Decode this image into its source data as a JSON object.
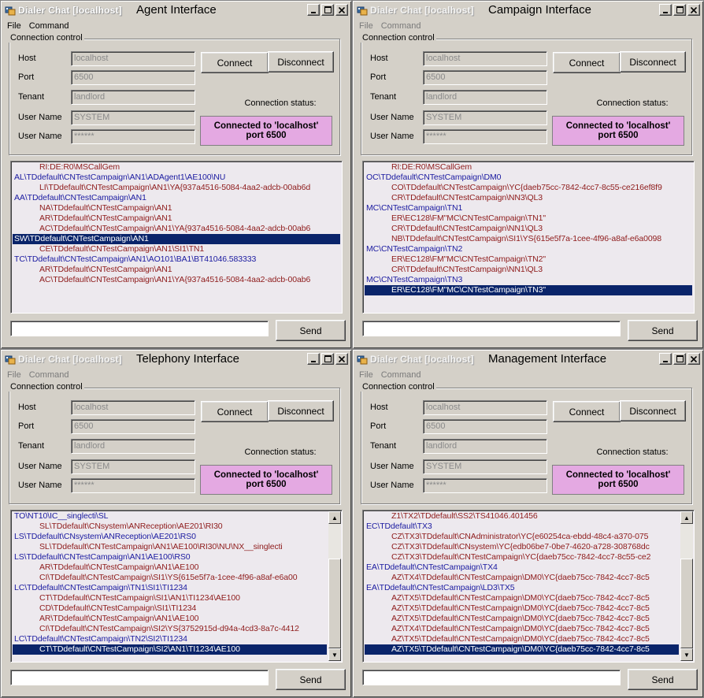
{
  "windows": [
    {
      "app_title": "Dialer Chat [localhost]",
      "interface_title": "Agent Interface",
      "active": true,
      "menu": [
        "File",
        "Command"
      ],
      "group_label": "Connection control",
      "fields": [
        {
          "label": "Host",
          "value": "localhost"
        },
        {
          "label": "Port",
          "value": "6500"
        },
        {
          "label": "Tenant",
          "value": "landlord"
        },
        {
          "label": "User Name",
          "value": "SYSTEM"
        },
        {
          "label": "User Name",
          "value": "******"
        }
      ],
      "connect_label": "Connect",
      "disconnect_label": "Disconnect",
      "status_label": "Connection status:",
      "status_text": "Connected to 'localhost' port 6500",
      "send_label": "Send",
      "input_value": "",
      "has_scrollbar": false,
      "log": [
        {
          "text": "RI:DE:R0\\MSCallGem",
          "color": "red"
        },
        {
          "text": "AL\\TDdefault\\CNTestCampaign\\AN1\\ADAgent1\\AE100\\NU",
          "color": "blue"
        },
        {
          "text": "LI\\TDdefault\\CNTestCampaign\\AN1\\YA{937a4516-5084-4aa2-adcb-00ab6d",
          "color": "red"
        },
        {
          "text": "AA\\TDdefault\\CNTestCampaign\\AN1",
          "color": "blue"
        },
        {
          "text": "NA\\TDdefault\\CNTestCampaign\\AN1",
          "color": "red"
        },
        {
          "text": "AR\\TDdefault\\CNTestCampaign\\AN1",
          "color": "red"
        },
        {
          "text": "AC\\TDdefault\\CNTestCampaign\\AN1\\YA{937a4516-5084-4aa2-adcb-00ab6",
          "color": "red"
        },
        {
          "text": "SW\\TDdefault\\CNTestCampaign\\AN1",
          "color": "blue",
          "selected": true
        },
        {
          "text": "CE\\TDdefault\\CNTestCampaign\\AN1\\SI1\\TN1",
          "color": "red"
        },
        {
          "text": "TC\\TDdefault\\CNTestCampaign\\AN1\\AO101\\BA1\\BT41046.583333",
          "color": "blue"
        },
        {
          "text": "AR\\TDdefault\\CNTestCampaign\\AN1",
          "color": "red"
        },
        {
          "text": "AC\\TDdefault\\CNTestCampaign\\AN1\\YA{937a4516-5084-4aa2-adcb-00ab6",
          "color": "red"
        }
      ]
    },
    {
      "app_title": "Dialer Chat [localhost]",
      "interface_title": "Campaign Interface",
      "active": false,
      "menu": [
        "File",
        "Command"
      ],
      "group_label": "Connection control",
      "fields": [
        {
          "label": "Host",
          "value": "localhost"
        },
        {
          "label": "Port",
          "value": "6500"
        },
        {
          "label": "Tenant",
          "value": "landlord"
        },
        {
          "label": "User Name",
          "value": "SYSTEM"
        },
        {
          "label": "User Name",
          "value": "******"
        }
      ],
      "connect_label": "Connect",
      "disconnect_label": "Disconnect",
      "status_label": "Connection status:",
      "status_text": "Connected to 'localhost' port 6500",
      "send_label": "Send",
      "input_value": "",
      "has_scrollbar": false,
      "log": [
        {
          "text": "RI:DE:R0\\MSCallGem",
          "color": "red"
        },
        {
          "text": "OC\\TDdefault\\CNTestCampaign\\DM0",
          "color": "blue"
        },
        {
          "text": "CO\\TDdefault\\CNTestCampaign\\YC{daeb75cc-7842-4cc7-8c55-ce216ef8f9",
          "color": "red"
        },
        {
          "text": "CR\\TDdefault\\CNTestCampaign\\NN3\\QL3",
          "color": "red"
        },
        {
          "text": "MC\\CNTestCampaign\\TN1",
          "color": "blue"
        },
        {
          "text": "ER\\EC128\\FM\"MC\\CNTestCampaign\\TN1\"",
          "color": "red"
        },
        {
          "text": "CR\\TDdefault\\CNTestCampaign\\NN1\\QL3",
          "color": "red"
        },
        {
          "text": "NB\\TDdefault\\CNTestCampaign\\SI1\\YS{615e5f7a-1cee-4f96-a8af-e6a0098",
          "color": "red"
        },
        {
          "text": "MC\\CNTestCampaign\\TN2",
          "color": "blue"
        },
        {
          "text": "ER\\EC128\\FM\"MC\\CNTestCampaign\\TN2\"",
          "color": "red"
        },
        {
          "text": "CR\\TDdefault\\CNTestCampaign\\NN1\\QL3",
          "color": "red"
        },
        {
          "text": "MC\\CNTestCampaign\\TN3",
          "color": "blue"
        },
        {
          "text": "ER\\EC128\\FM\"MC\\CNTestCampaign\\TN3\"",
          "color": "red",
          "selected": true
        }
      ]
    },
    {
      "app_title": "Dialer Chat [localhost]",
      "interface_title": "Telephony Interface",
      "active": false,
      "menu": [
        "File",
        "Command"
      ],
      "group_label": "Connection control",
      "fields": [
        {
          "label": "Host",
          "value": "localhost"
        },
        {
          "label": "Port",
          "value": "6500"
        },
        {
          "label": "Tenant",
          "value": "landlord"
        },
        {
          "label": "User Name",
          "value": "SYSTEM"
        },
        {
          "label": "User Name",
          "value": "******"
        }
      ],
      "connect_label": "Connect",
      "disconnect_label": "Disconnect",
      "status_label": "Connection status:",
      "status_text": "Connected to 'localhost' port 6500",
      "send_label": "Send",
      "input_value": "",
      "has_scrollbar": true,
      "scroll_position": 1.0,
      "log": [
        {
          "text": "TO\\NT10\\IC__singlecti\\SL",
          "color": "blue"
        },
        {
          "text": "SL\\TDdefault\\CNsystem\\ANReception\\AE201\\RI30",
          "color": "red"
        },
        {
          "text": "LS\\TDdefault\\CNsystem\\ANReception\\AE201\\RS0",
          "color": "blue"
        },
        {
          "text": "SL\\TDdefault\\CNTestCampaign\\AN1\\AE100\\RI30\\NU\\NX__singlecti",
          "color": "red"
        },
        {
          "text": "LS\\TDdefault\\CNTestCampaign\\AN1\\AE100\\RS0",
          "color": "blue"
        },
        {
          "text": "AR\\TDdefault\\CNTestCampaign\\AN1\\AE100",
          "color": "red"
        },
        {
          "text": "CI\\TDdefault\\CNTestCampaign\\SI1\\YS{615e5f7a-1cee-4f96-a8af-e6a00",
          "color": "red"
        },
        {
          "text": "LC\\TDdefault\\CNTestCampaign\\TN1\\SI1\\TI1234",
          "color": "blue"
        },
        {
          "text": "CT\\TDdefault\\CNTestCampaign\\SI1\\AN1\\TI1234\\AE100",
          "color": "red"
        },
        {
          "text": "CD\\TDdefault\\CNTestCampaign\\SI1\\TI1234",
          "color": "red"
        },
        {
          "text": "AR\\TDdefault\\CNTestCampaign\\AN1\\AE100",
          "color": "red"
        },
        {
          "text": "CI\\TDdefault\\CNTestCampaign\\SI2\\YS{3752915d-d94a-4cd3-8a7c-4412",
          "color": "red"
        },
        {
          "text": "LC\\TDdefault\\CNTestCampaign\\TN2\\SI2\\TI1234",
          "color": "blue"
        },
        {
          "text": "CT\\TDdefault\\CNTestCampaign\\SI2\\AN1\\TI1234\\AE100",
          "color": "red",
          "selected": true
        }
      ]
    },
    {
      "app_title": "Dialer Chat [localhost]",
      "interface_title": "Management Interface",
      "active": false,
      "menu": [
        "File",
        "Command"
      ],
      "group_label": "Connection control",
      "fields": [
        {
          "label": "Host",
          "value": "localhost"
        },
        {
          "label": "Port",
          "value": "6500"
        },
        {
          "label": "Tenant",
          "value": "landlord"
        },
        {
          "label": "User Name",
          "value": "SYSTEM"
        },
        {
          "label": "User Name",
          "value": "******"
        }
      ],
      "connect_label": "Connect",
      "disconnect_label": "Disconnect",
      "status_label": "Connection status:",
      "status_text": "Connected to 'localhost' port 6500",
      "send_label": "Send",
      "input_value": "",
      "has_scrollbar": true,
      "scroll_position": 1.0,
      "log": [
        {
          "text": "Z1\\TX2\\TDdefault\\SS2\\TS41046.401456",
          "color": "red"
        },
        {
          "text": "EC\\TDdefault\\TX3",
          "color": "blue"
        },
        {
          "text": "CZ\\TX3\\TDdefault\\CNAdministrator\\YC{e60254ca-ebdd-48c4-a370-075",
          "color": "red"
        },
        {
          "text": "CZ\\TX3\\TDdefault\\CNsystem\\YC{edb06be7-0be7-4620-a728-308768dc",
          "color": "red"
        },
        {
          "text": "CZ\\TX3\\TDdefault\\CNTestCampaign\\YC{daeb75cc-7842-4cc7-8c55-ce2",
          "color": "red"
        },
        {
          "text": "EA\\TDdefault\\CNTestCampaign\\TX4",
          "color": "blue"
        },
        {
          "text": "AZ\\TX4\\TDdefault\\CNTestCampaign\\DM0\\YC{daeb75cc-7842-4cc7-8c5",
          "color": "red"
        },
        {
          "text": "EA\\TDdefault\\CNTestCampaign\\LD3\\TX5",
          "color": "blue"
        },
        {
          "text": "AZ\\TX5\\TDdefault\\CNTestCampaign\\DM0\\YC{daeb75cc-7842-4cc7-8c5",
          "color": "red"
        },
        {
          "text": "AZ\\TX5\\TDdefault\\CNTestCampaign\\DM0\\YC{daeb75cc-7842-4cc7-8c5",
          "color": "red"
        },
        {
          "text": "AZ\\TX5\\TDdefault\\CNTestCampaign\\DM0\\YC{daeb75cc-7842-4cc7-8c5",
          "color": "red"
        },
        {
          "text": "AZ\\TX4\\TDdefault\\CNTestCampaign\\DM0\\YC{daeb75cc-7842-4cc7-8c5",
          "color": "red"
        },
        {
          "text": "AZ\\TX5\\TDdefault\\CNTestCampaign\\DM0\\YC{daeb75cc-7842-4cc7-8c5",
          "color": "red"
        },
        {
          "text": "AZ\\TX5\\TDdefault\\CNTestCampaign\\DM0\\YC{daeb75cc-7842-4cc7-8c5",
          "color": "red",
          "selected": true
        }
      ]
    }
  ],
  "colors": {
    "window_bg": "#d4d0c8",
    "status_bg": "#e4a9e2",
    "log_bg": "#ede9ee",
    "log_blue": "#1a1aa0",
    "log_red": "#8e1b1b",
    "selection": "#0a246a"
  },
  "icons": {
    "app": "dialer-app-icon",
    "minimize": "minimize-icon",
    "maximize": "maximize-icon",
    "close": "close-icon"
  }
}
